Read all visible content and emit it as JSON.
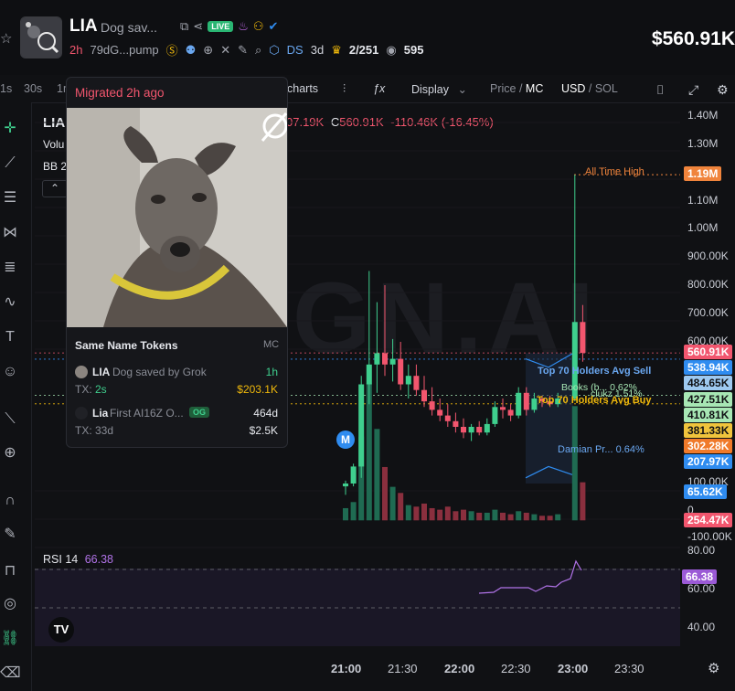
{
  "header": {
    "ticker": "LIA",
    "name": "Dog sav...",
    "live": "LIVE",
    "age": "2h",
    "address": "79dG...pump",
    "ds": "DS",
    "ds_age": "3d",
    "holders_ratio": "2/251",
    "views": "595",
    "price": "$560.91K"
  },
  "toolbar": {
    "intervals": [
      "1s",
      "30s",
      "1m"
    ],
    "charts": "charts",
    "display": "Display",
    "price_label": "Price",
    "mc_label": "MC",
    "usd_label": "USD",
    "sol_label": "SOL"
  },
  "legend": {
    "symbol": "LIA",
    "volume": "Volu",
    "bb": "BB 2",
    "ohlc_tail": "07.19K",
    "close_label": "C",
    "close": "560.91K",
    "change": "-110.46K (-16.45%)"
  },
  "popup": {
    "migrated": "Migrated 2h ago",
    "same_name": "Same Name Tokens",
    "mc": "MC",
    "tokens": [
      {
        "ticker": "LIA",
        "name": "Dog saved by Grok",
        "age": "1h",
        "tx": "TX:",
        "tx_time": "2s",
        "mc": "$203.1K"
      },
      {
        "ticker": "Lia",
        "name": "First AI16Z O...",
        "badge": "OG",
        "age": "464d",
        "tx": "TX:",
        "tx_time": "33d",
        "mc": "$2.5K"
      }
    ]
  },
  "chart_data": {
    "type": "candlestick",
    "y_ticks": [
      "1.40M",
      "1.30M",
      "1.20M",
      "1.10M",
      "1.00M",
      "900.00K",
      "800.00K",
      "700.00K",
      "600.00K",
      "100.00K",
      "0",
      "-100.00K"
    ],
    "x_ticks": [
      "21:00",
      "21:30",
      "22:00",
      "22:30",
      "23:00",
      "23:30"
    ],
    "ylim": [
      -100000,
      1400000
    ],
    "candles": [
      {
        "o": 90000,
        "h": 110000,
        "l": 60000,
        "c": 100000
      },
      {
        "o": 100000,
        "h": 170000,
        "l": 90000,
        "c": 160000
      },
      {
        "o": 160000,
        "h": 480000,
        "l": 120000,
        "c": 450000
      },
      {
        "o": 450000,
        "h": 850000,
        "l": 380000,
        "c": 520000
      },
      {
        "o": 520000,
        "h": 740000,
        "l": 420000,
        "c": 560000
      },
      {
        "o": 560000,
        "h": 800000,
        "l": 480000,
        "c": 520000
      },
      {
        "o": 520000,
        "h": 610000,
        "l": 460000,
        "c": 540000
      },
      {
        "o": 540000,
        "h": 600000,
        "l": 430000,
        "c": 450000
      },
      {
        "o": 450000,
        "h": 520000,
        "l": 400000,
        "c": 480000
      },
      {
        "o": 480000,
        "h": 520000,
        "l": 410000,
        "c": 430000
      },
      {
        "o": 430000,
        "h": 480000,
        "l": 370000,
        "c": 390000
      },
      {
        "o": 390000,
        "h": 440000,
        "l": 340000,
        "c": 360000
      },
      {
        "o": 360000,
        "h": 400000,
        "l": 320000,
        "c": 340000
      },
      {
        "o": 340000,
        "h": 380000,
        "l": 300000,
        "c": 320000
      },
      {
        "o": 320000,
        "h": 350000,
        "l": 280000,
        "c": 300000
      },
      {
        "o": 300000,
        "h": 330000,
        "l": 260000,
        "c": 280000
      },
      {
        "o": 280000,
        "h": 310000,
        "l": 250000,
        "c": 300000
      },
      {
        "o": 300000,
        "h": 320000,
        "l": 270000,
        "c": 280000
      },
      {
        "o": 280000,
        "h": 330000,
        "l": 270000,
        "c": 310000
      },
      {
        "o": 310000,
        "h": 390000,
        "l": 300000,
        "c": 370000
      },
      {
        "o": 370000,
        "h": 400000,
        "l": 330000,
        "c": 360000
      },
      {
        "o": 360000,
        "h": 380000,
        "l": 320000,
        "c": 340000
      },
      {
        "o": 340000,
        "h": 440000,
        "l": 330000,
        "c": 420000
      },
      {
        "o": 420000,
        "h": 440000,
        "l": 340000,
        "c": 360000
      },
      {
        "o": 360000,
        "h": 420000,
        "l": 350000,
        "c": 400000
      },
      {
        "o": 400000,
        "h": 410000,
        "l": 370000,
        "c": 390000
      },
      {
        "o": 390000,
        "h": 410000,
        "l": 370000,
        "c": 380000
      },
      {
        "o": 380000,
        "h": 420000,
        "l": 370000,
        "c": 400000
      },
      {
        "o": 400000,
        "h": 1190000,
        "l": 390000,
        "c": 670000
      },
      {
        "o": 670000,
        "h": 730000,
        "l": 530000,
        "c": 560910
      }
    ],
    "volumes": [
      8,
      12,
      55,
      90,
      60,
      35,
      22,
      18,
      10,
      9,
      11,
      8,
      7,
      9,
      6,
      7,
      6,
      5,
      5,
      7,
      5,
      4,
      6,
      5,
      4,
      3,
      3,
      4,
      75,
      25
    ],
    "rsi": {
      "label": "RSI",
      "period": "14",
      "value": "66.38",
      "ticks": [
        "80.00",
        "60.00",
        "40.00"
      ]
    },
    "annotations": {
      "ath": "All Time High",
      "top70_sell": "Top 70 Holders Avg Sell",
      "top70_buy": "Top 70 Holders Avg Buy",
      "books": "Books (b...  0.62%",
      "clukz": "clukz  1.51%",
      "damian": "Damian Pr...  0.64%"
    },
    "price_tags": [
      {
        "v": "1.19M",
        "bg": "#f0843c",
        "fg": "#ffffff"
      },
      {
        "v": "560.91K",
        "bg": "#f2566e",
        "fg": "#ffffff"
      },
      {
        "v": "538.94K",
        "bg": "#2f8cf0",
        "fg": "#ffffff"
      },
      {
        "v": "484.65K",
        "bg": "#9ec9f0",
        "fg": "#101114"
      },
      {
        "v": "427.51K",
        "bg": "#a7e7b4",
        "fg": "#101114"
      },
      {
        "v": "410.81K",
        "bg": "#a7e7b4",
        "fg": "#101114"
      },
      {
        "v": "381.33K",
        "bg": "#f0c43c",
        "fg": "#101114"
      },
      {
        "v": "302.28K",
        "bg": "#f07a2a",
        "fg": "#ffffff"
      },
      {
        "v": "207.97K",
        "bg": "#2f8cf0",
        "fg": "#ffffff"
      },
      {
        "v": "65.62K",
        "bg": "#2f8cf0",
        "fg": "#ffffff"
      },
      {
        "v": "254.47K",
        "bg": "#f2566e",
        "fg": "#ffffff"
      }
    ],
    "marker": "M",
    "watermark": "GN.AI"
  }
}
